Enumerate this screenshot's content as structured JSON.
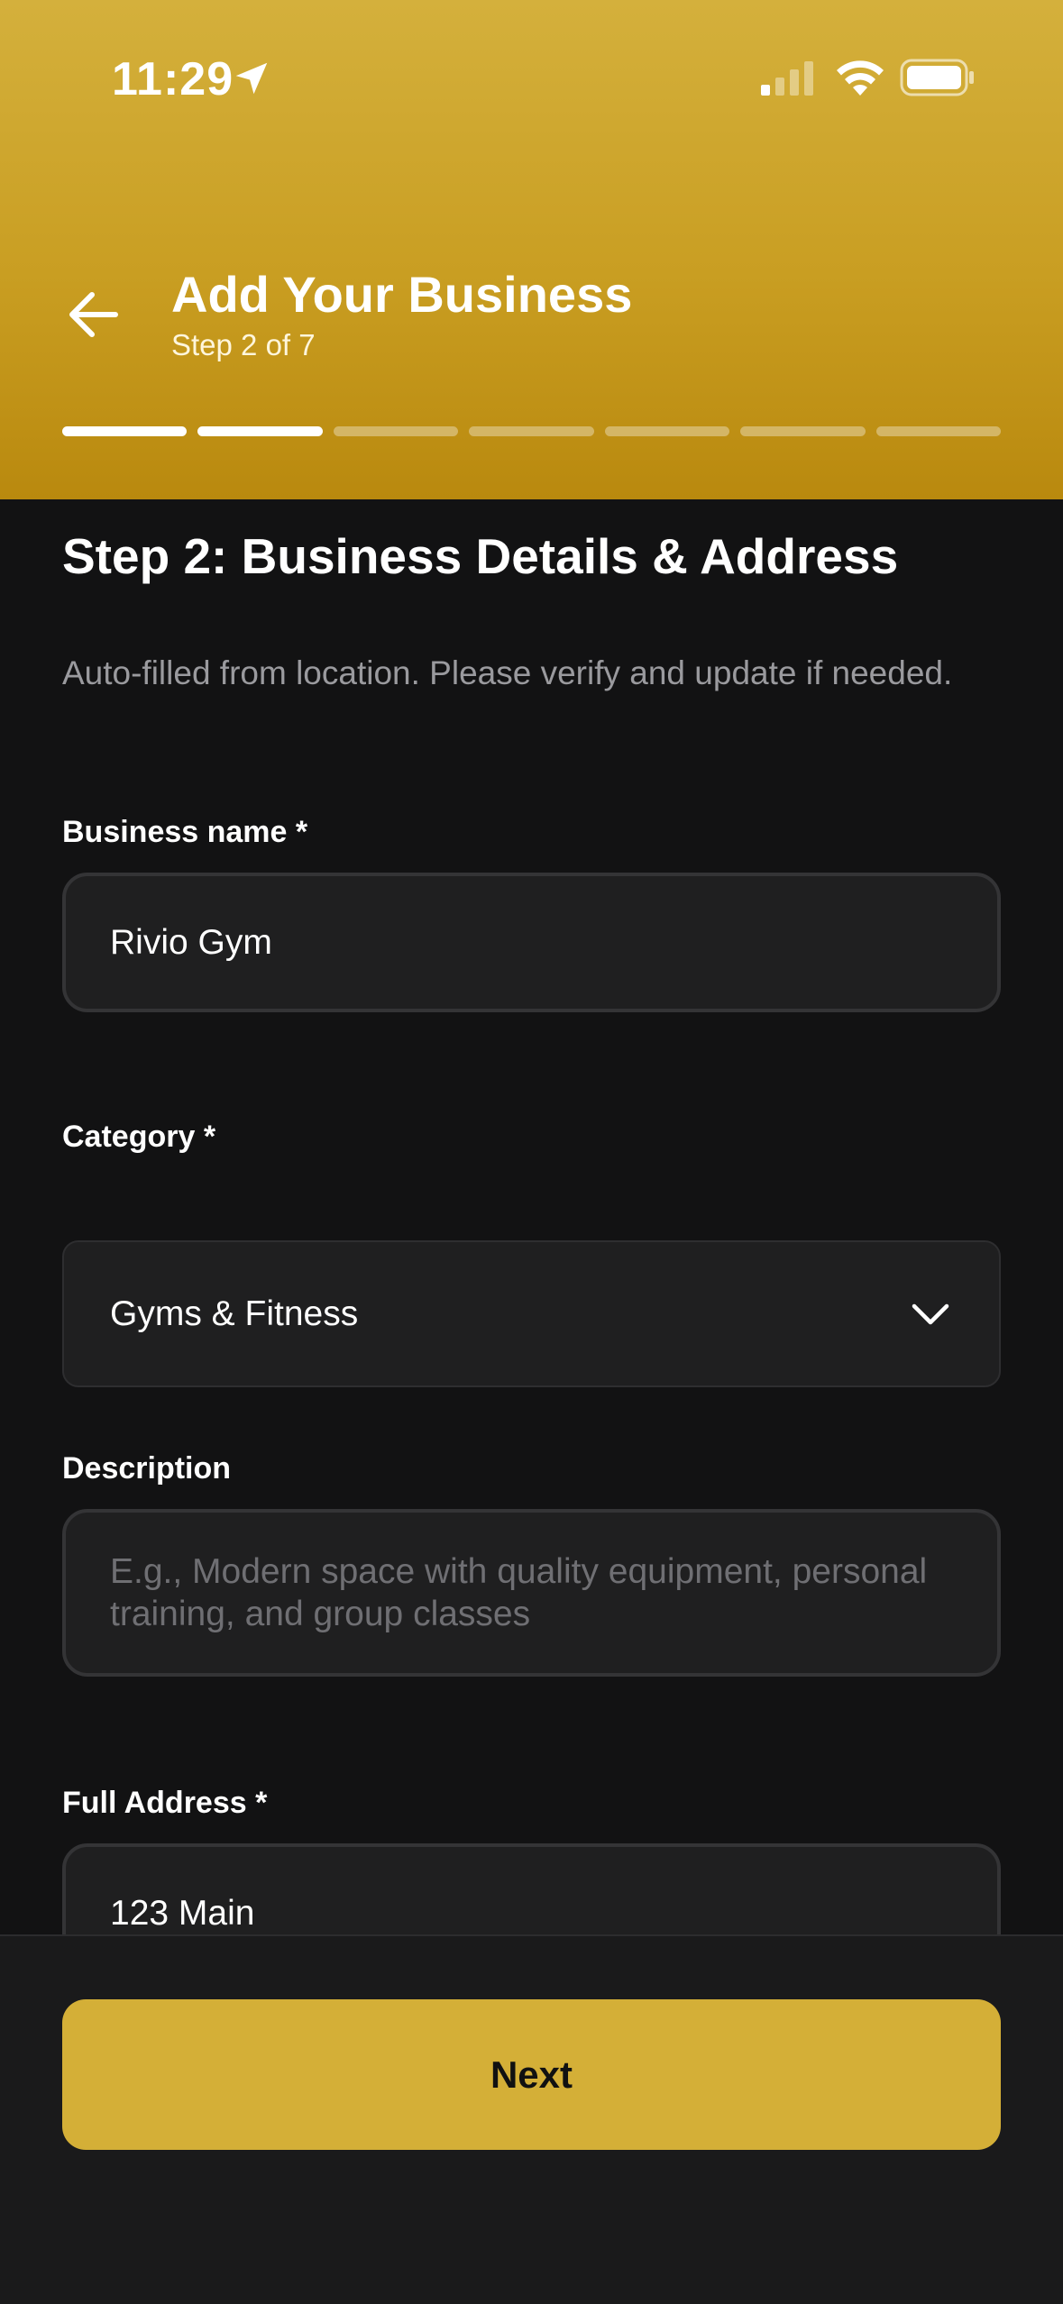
{
  "status_bar": {
    "time": "11:29",
    "icons": [
      "location-arrow-icon",
      "cellular-signal-icon",
      "wifi-icon",
      "battery-icon"
    ]
  },
  "header": {
    "back_icon": "arrow-left-icon",
    "title": "Add Your Business",
    "subtitle": "Step 2 of 7",
    "progress": {
      "current_step": 2,
      "total_steps": 7
    }
  },
  "form": {
    "heading": "Step 2: Business Details & Address",
    "hint": "Auto-filled from location. Please verify and update if needed.",
    "business_name": {
      "label": "Business name *",
      "value": "Rivio Gym"
    },
    "category": {
      "label": "Category *",
      "value": "Gyms & Fitness",
      "icon": "chevron-down-icon"
    },
    "description": {
      "label": "Description",
      "value": "",
      "placeholder": "E.g., Modern space with quality equipment, personal training, and group classes"
    },
    "full_address": {
      "label": "Full Address *",
      "value": "123 Main"
    }
  },
  "footer": {
    "next_label": "Next"
  },
  "colors": {
    "accent": "#d4af37",
    "header_gradient_top": "#d4b03c",
    "header_gradient_bottom": "#b9890e",
    "background": "#121213",
    "field_background": "#1f1f20",
    "field_border": "#343436"
  }
}
